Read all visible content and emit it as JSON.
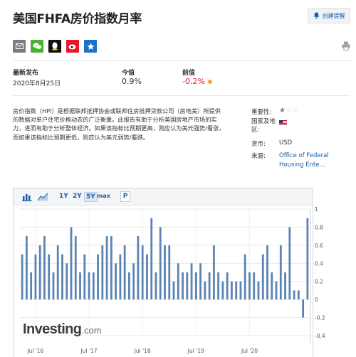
{
  "header": {
    "title": "美国FHFA房价指数月率",
    "alert_label": "创建提醒"
  },
  "share_icons": [
    "mail-icon",
    "wechat-icon",
    "qq-icon",
    "weibo-icon",
    "favorite-star-icon"
  ],
  "stats": {
    "latest_label": "最新发布",
    "latest_date": "2020年8月25日",
    "actual_label": "今值",
    "actual_value": "0.9%",
    "previous_label": "前值",
    "previous_value": "-0.2%"
  },
  "description": "房价指数（HPI）是根据联邦抵押协会或联邦住房抵押贷款公司（房地美）所提供的数据对单户住宅价格动态的广泛衡量。此报告有助于分析美国房地产市场的实力，进而有助于分析整体经济。如果该指标比预期更高，则应认为美元强势/看涨，而如果该指标比预期更低，则应认为美元弱势/看跌。",
  "info": {
    "importance_label": "重要性:",
    "importance_stars": 1,
    "importance_max": 3,
    "country_label": "国家及地区:",
    "currency_label": "货币:",
    "currency_value": "USD",
    "source_label": "来源:",
    "source_value": "Office of Federal Housing Ente..."
  },
  "chart_toolbar": {
    "ranges": [
      "1Y",
      "2Y",
      "5Y"
    ],
    "active_range": "5Y",
    "max_label": "max",
    "p_label": "P"
  },
  "logo": {
    "main": "Investing",
    "suffix": ".com"
  },
  "colors": {
    "bar": "#5b84b3",
    "negative": "#e0232d",
    "accent_link": "#1f5aa6",
    "dot": "#f5a623"
  },
  "chart_data": {
    "type": "bar",
    "x_tick_labels": [
      "Jul '16",
      "Jul '17",
      "Jul '18",
      "Jul '19",
      "Jul '20"
    ],
    "y_tick_labels": [
      "1",
      "0.8",
      "0.6",
      "0.4",
      "0.2",
      "0",
      "-0.2",
      "-0.4"
    ],
    "ylim": [
      -0.4,
      1.0
    ],
    "grid": true,
    "values": [
      0.5,
      0.7,
      0.3,
      0.5,
      0.6,
      0.7,
      0.5,
      0.3,
      0.6,
      0.5,
      0.4,
      0.8,
      0.7,
      0.3,
      0.5,
      0.3,
      0.3,
      0.5,
      0.6,
      0.7,
      0.7,
      0.4,
      0.5,
      0.6,
      0.3,
      0.4,
      0.7,
      0.6,
      0.5,
      0.9,
      0.3,
      0.8,
      0.6,
      0.6,
      0.2,
      0.4,
      0.3,
      0.3,
      0.4,
      0.3,
      0.4,
      0.2,
      0.3,
      0.6,
      0.3,
      0.2,
      0.3,
      0.2,
      0.2,
      0.2,
      0.5,
      0.3,
      0.3,
      0.2,
      0.5,
      0.6,
      0.3,
      0.2,
      0.6,
      0.3,
      0.8,
      0.1,
      0.1,
      -0.2,
      0.9
    ]
  }
}
